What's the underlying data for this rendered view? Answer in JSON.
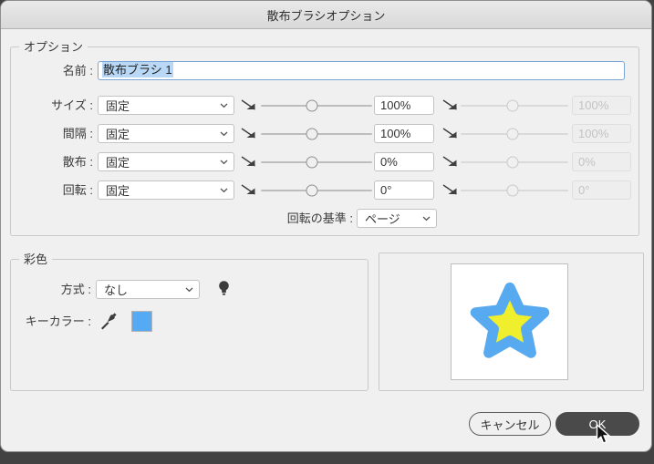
{
  "titlebar": {
    "title": "散布ブラシオプション"
  },
  "options": {
    "legend": "オプション",
    "name_label": "名前 :",
    "name_value": "散布ブラシ 1",
    "rows": [
      {
        "label": "サイズ :",
        "mode": "固定",
        "value": "100%",
        "value2": "100%"
      },
      {
        "label": "間隔 :",
        "mode": "固定",
        "value": "100%",
        "value2": "100%"
      },
      {
        "label": "散布 :",
        "mode": "固定",
        "value": "0%",
        "value2": "0%"
      },
      {
        "label": "回転 :",
        "mode": "固定",
        "value": "0°",
        "value2": "0°"
      }
    ],
    "rotation_basis": {
      "label": "回転の基準 :",
      "value": "ページ"
    }
  },
  "colorization": {
    "legend": "彩色",
    "method_label": "方式 :",
    "method_value": "なし",
    "key_color_label": "キーカラー :"
  },
  "buttons": {
    "cancel": "キャンセル",
    "ok": "OK"
  },
  "icons": {
    "flag": "slider-range-flag",
    "chevron": "chevron-down",
    "bulb": "colorization-tips-bulb",
    "eyedropper": "key-color-eyedropper",
    "cursor": "mouse-arrow"
  },
  "colors": {
    "key_color_swatch": "#55aaf3",
    "star_fill": "#f0ef2e",
    "star_stroke": "#57aaf0",
    "ok_button_bg": "#4a4a4a",
    "dialog_bg": "#f0f0f0"
  },
  "preview": {
    "content": "star-brush-shape"
  }
}
